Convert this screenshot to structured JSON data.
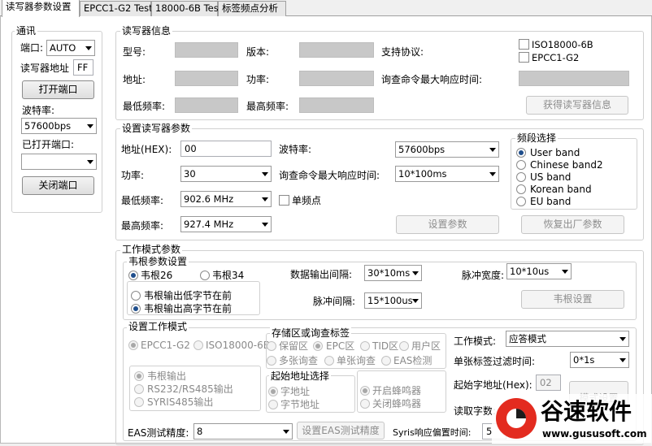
{
  "tabs": [
    "读写器参数设置",
    "EPCC1-G2 Test",
    "18000-6B Test",
    "标签频点分析"
  ],
  "comm": {
    "title": "通讯",
    "port_label": "端口:",
    "port_value": "AUTO",
    "addr_label": "读写器地址",
    "addr_value": "FF",
    "open_btn": "打开端口",
    "baud_label": "波特率:",
    "baud_value": "57600bps",
    "opened_label": "已打开端口:",
    "opened_value": "",
    "close_btn": "关闭端口"
  },
  "info": {
    "title": "读写器信息",
    "model": "型号:",
    "version": "版本:",
    "protocols": "支持协议:",
    "proto_iso": "ISO18000-6B",
    "proto_epc": "EPCC1-G2",
    "address": "地址:",
    "power": "功率:",
    "max_resp": "询查命令最大响应时间:",
    "min_freq": "最低频率:",
    "max_freq": "最高频率:",
    "get_btn": "获得读写器信息"
  },
  "params": {
    "title": "设置读写器参数",
    "addr_label": "地址(HEX):",
    "addr_value": "00",
    "baud_label": "波特率:",
    "baud_value": "57600bps",
    "power_label": "功率:",
    "power_value": "30",
    "resp_label": "询查命令最大响应时间:",
    "resp_value": "10*100ms",
    "minf_label": "最低频率:",
    "minf_value": "902.6 MHz",
    "single_label": "单频点",
    "maxf_label": "最高频率:",
    "maxf_value": "927.4 MHz",
    "set_btn": "设置参数",
    "restore_btn": "恢复出厂参数"
  },
  "band": {
    "title": "频段选择",
    "options": [
      "User band",
      "Chinese band2",
      "US band",
      "Korean band",
      "EU band"
    ],
    "selected": 0
  },
  "work": {
    "title": "工作模式参数",
    "wiegand_title": "韦根参数设置",
    "w26": "韦根26",
    "w34": "韦根34",
    "low_first": "韦根输出低字节在前",
    "high_first": "韦根输出高字节在前",
    "data_interval_label": "数据输出间隔:",
    "data_interval_value": "30*10ms",
    "pulse_width_label": "脉冲宽度:",
    "pulse_width_value": "10*10us",
    "pulse_interval_label": "脉冲间隔:",
    "pulse_interval_value": "15*100us",
    "wiegand_btn": "韦根设置"
  },
  "mode": {
    "title": "设置工作模式",
    "epc": "EPCC1-G2",
    "iso": "ISO18000-6B",
    "out_wiegand": "韦根输出",
    "out_rs": "RS232/RS485输出",
    "out_syris": "SYRIS485输出",
    "storage_title": "存储区或询查标签",
    "reserve": "保留区",
    "epc_area": "EPC区",
    "tid": "TID区",
    "user": "用户区",
    "multi": "多张询查",
    "single": "单张询查",
    "eas": "EAS检测",
    "start_title": "起始地址选择",
    "word_addr": "字地址",
    "byte_addr": "字节地址",
    "buzz_on": "开启蜂鸣器",
    "buzz_off": "关闭蜂鸣器",
    "work_mode_label": "工作模式:",
    "work_mode_value": "应答模式",
    "filter_label": "单张标签过滤时间:",
    "filter_value": "0*1s",
    "start_addr_label": "起始字地址(Hex):",
    "start_addr_value": "02",
    "read_count_label": "读取字数:",
    "mode_btn": "模式设置",
    "eas_label": "EAS测试精度:",
    "eas_value": "8",
    "eas_btn": "设置EAS测试精度",
    "syris_label": "Syris响应偏置时间:",
    "syris_value": "5"
  },
  "watermark": {
    "name": "谷速软件",
    "url": "www.gususoft.com"
  }
}
